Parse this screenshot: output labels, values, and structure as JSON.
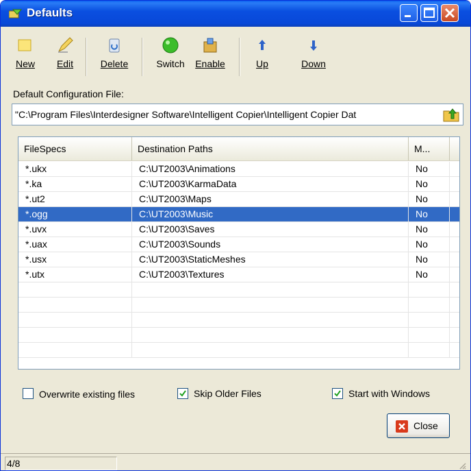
{
  "window": {
    "title": "Defaults"
  },
  "toolbar": {
    "new_label": "New",
    "edit_label": "Edit",
    "delete_label": "Delete",
    "switch_label": "Switch",
    "enable_label": "Enable",
    "up_label": "Up",
    "down_label": "Down"
  },
  "config": {
    "label": "Default Configuration File:",
    "value": "\"C:\\Program Files\\Interdesigner Software\\Intelligent Copier\\Intelligent Copier Dat"
  },
  "table": {
    "columns": [
      "FileSpecs",
      "Destination Paths",
      "M..."
    ],
    "rows": [
      [
        "*.ukx",
        "C:\\UT2003\\Animations",
        "No"
      ],
      [
        "*.ka",
        "C:\\UT2003\\KarmaData",
        "No"
      ],
      [
        "*.ut2",
        "C:\\UT2003\\Maps",
        "No"
      ],
      [
        "*.ogg",
        "C:\\UT2003\\Music",
        "No"
      ],
      [
        "*.uvx",
        "C:\\UT2003\\Saves",
        "No"
      ],
      [
        "*.uax",
        "C:\\UT2003\\Sounds",
        "No"
      ],
      [
        "*.usx",
        "C:\\UT2003\\StaticMeshes",
        "No"
      ],
      [
        "*.utx",
        "C:\\UT2003\\Textures",
        "No"
      ]
    ],
    "selected_row": 3
  },
  "options": {
    "overwrite_label": "Overwrite existing files",
    "overwrite_checked": false,
    "skip_older_label": "Skip Older Files",
    "skip_older_checked": true,
    "start_windows_label": "Start with Windows",
    "start_windows_checked": true
  },
  "close_label": "Close",
  "status": {
    "position": "4/8"
  },
  "colors": {
    "titlebar": "#0a4fe0",
    "selection": "#316ac5",
    "face": "#ece9d8"
  }
}
